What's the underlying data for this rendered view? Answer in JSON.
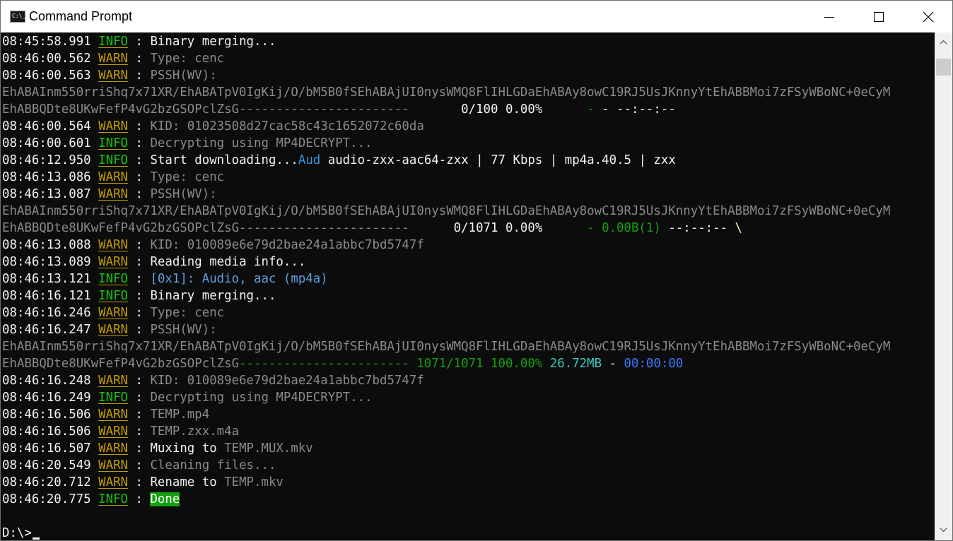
{
  "window": {
    "title": "Command Prompt",
    "icon": "cmd-icon",
    "icon_glyph": "C:\\_",
    "controls": [
      "minimize-icon",
      "maximize-icon",
      "close-icon"
    ]
  },
  "console": {
    "lines": [
      {
        "ts": "08:45:58.991",
        "lvl": "INFO",
        "segs": [
          {
            "t": "Binary merging...",
            "c": "bright"
          }
        ]
      },
      {
        "ts": "08:46:00.562",
        "lvl": "WARN",
        "segs": [
          {
            "t": "Type: cenc",
            "c": "dim"
          }
        ]
      },
      {
        "ts": "08:46:00.563",
        "lvl": "WARN",
        "segs": [
          {
            "t": "PSSH(WV):",
            "c": "dim"
          }
        ]
      },
      {
        "segs": [
          {
            "t": "EhABAInm550rriShq7x71XR/EhABATpV0IgKij/O/bM5B0fSEhABAjUI0nysWMQ8FlIHLGDaEhABAy8owC19RJ5UsJKnnyYtEhABBMoi7zFSyWBoNC+0eCyM",
            "c": "dim"
          }
        ]
      },
      {
        "segs": [
          {
            "t": "EhABBQDte8UKwFefP4vG2bzGSOPclZsG",
            "c": "dim"
          },
          {
            "t": "-----------------------",
            "c": "dim"
          },
          {
            "t": "       0/100 0.00%      ",
            "c": "bright"
          },
          {
            "t": "-",
            "c": "green2"
          },
          {
            "t": " - --:--:--",
            "c": "bright"
          }
        ]
      },
      {
        "ts": "08:46:00.564",
        "lvl": "WARN",
        "segs": [
          {
            "t": "KID: 01023508d27cac58c43c1652072c60da",
            "c": "dim"
          }
        ]
      },
      {
        "ts": "08:46:00.601",
        "lvl": "INFO",
        "segs": [
          {
            "t": "Decrypting using MP4DECRYPT...",
            "c": "dim"
          }
        ]
      },
      {
        "ts": "08:46:12.950",
        "lvl": "INFO",
        "segs": [
          {
            "t": "Start downloading...",
            "c": "bright"
          },
          {
            "t": "Aud",
            "c": "cyan"
          },
          {
            "t": " audio-zxx-aac64-zxx | 77 Kbps | mp4a.40.5 | zxx",
            "c": "bright"
          }
        ]
      },
      {
        "ts": "08:46:13.086",
        "lvl": "WARN",
        "segs": [
          {
            "t": "Type: cenc",
            "c": "dim"
          }
        ]
      },
      {
        "ts": "08:46:13.087",
        "lvl": "WARN",
        "segs": [
          {
            "t": "PSSH(WV):",
            "c": "dim"
          }
        ]
      },
      {
        "segs": [
          {
            "t": "EhABAInm550rriShq7x71XR/EhABATpV0IgKij/O/bM5B0fSEhABAjUI0nysWMQ8FlIHLGDaEhABAy8owC19RJ5UsJKnnyYtEhABBMoi7zFSyWBoNC+0eCyM",
            "c": "dim"
          }
        ]
      },
      {
        "segs": [
          {
            "t": "EhABBQDte8UKwFefP4vG2bzGSOPclZsG",
            "c": "dim"
          },
          {
            "t": "-----------------------",
            "c": "dim"
          },
          {
            "t": "      0/1071 0.00%      ",
            "c": "bright"
          },
          {
            "t": "- 0.00B(1)",
            "c": "green2"
          },
          {
            "t": " --:--:-- ",
            "c": "bright"
          },
          {
            "t": "\\",
            "c": "yellow"
          }
        ]
      },
      {
        "ts": "08:46:13.088",
        "lvl": "WARN",
        "segs": [
          {
            "t": "KID: 010089e6e79d2bae24a1abbc7bd5747f",
            "c": "dim"
          }
        ]
      },
      {
        "ts": "08:46:13.089",
        "lvl": "WARN",
        "segs": [
          {
            "t": "Reading media info...",
            "c": "bright"
          }
        ]
      },
      {
        "ts": "08:46:13.121",
        "lvl": "INFO",
        "segs": [
          {
            "t": "[0x1]: Audio, aac (mp4a)",
            "c": "steel"
          }
        ]
      },
      {
        "ts": "08:46:16.121",
        "lvl": "INFO",
        "segs": [
          {
            "t": "Binary merging...",
            "c": "bright"
          }
        ]
      },
      {
        "ts": "08:46:16.246",
        "lvl": "WARN",
        "segs": [
          {
            "t": "Type: cenc",
            "c": "dim"
          }
        ]
      },
      {
        "ts": "08:46:16.247",
        "lvl": "WARN",
        "segs": [
          {
            "t": "PSSH(WV):",
            "c": "dim"
          }
        ]
      },
      {
        "segs": [
          {
            "t": "EhABAInm550rriShq7x71XR/EhABATpV0IgKij/O/bM5B0fSEhABAjUI0nysWMQ8FlIHLGDaEhABAy8owC19RJ5UsJKnnyYtEhABBMoi7zFSyWBoNC+0eCyM",
            "c": "dim"
          }
        ]
      },
      {
        "segs": [
          {
            "t": "EhABBQDte8UKwFefP4vG2bzGSOPclZsG",
            "c": "dim"
          },
          {
            "t": "-----------------------",
            "c": "green2"
          },
          {
            "t": " 1071/1071 100.00% ",
            "c": "green2"
          },
          {
            "t": "26.72MB",
            "c": "teal"
          },
          {
            "t": " - ",
            "c": "bright"
          },
          {
            "t": "00:00:00",
            "c": "blue"
          }
        ]
      },
      {
        "ts": "08:46:16.248",
        "lvl": "WARN",
        "segs": [
          {
            "t": "KID: 010089e6e79d2bae24a1abbc7bd5747f",
            "c": "dim"
          }
        ]
      },
      {
        "ts": "08:46:16.249",
        "lvl": "INFO",
        "segs": [
          {
            "t": "Decrypting using MP4DECRYPT...",
            "c": "dim"
          }
        ]
      },
      {
        "ts": "08:46:16.506",
        "lvl": "WARN",
        "segs": [
          {
            "t": "TEMP.mp4",
            "c": "dim"
          }
        ]
      },
      {
        "ts": "08:46:16.506",
        "lvl": "WARN",
        "segs": [
          {
            "t": "TEMP.zxx.m4a",
            "c": "dim"
          }
        ]
      },
      {
        "ts": "08:46:16.507",
        "lvl": "WARN",
        "segs": [
          {
            "t": "Muxing to ",
            "c": "bright"
          },
          {
            "t": "TEMP.MUX.mkv",
            "c": "dim"
          }
        ]
      },
      {
        "ts": "08:46:20.549",
        "lvl": "WARN",
        "segs": [
          {
            "t": "Cleaning files...",
            "c": "dim"
          }
        ]
      },
      {
        "ts": "08:46:20.712",
        "lvl": "WARN",
        "segs": [
          {
            "t": "Rename to ",
            "c": "bright"
          },
          {
            "t": "TEMP.mkv",
            "c": "dim"
          }
        ]
      },
      {
        "ts": "08:46:20.775",
        "lvl": "INFO",
        "segs": [
          {
            "t": "Done",
            "c": "done"
          }
        ]
      },
      {
        "segs": []
      },
      {
        "prompt": "D:\\>",
        "cursor": true
      }
    ]
  },
  "scrollbar": {
    "up": "scroll-up-arrow-icon",
    "down": "scroll-down-arrow-icon"
  }
}
